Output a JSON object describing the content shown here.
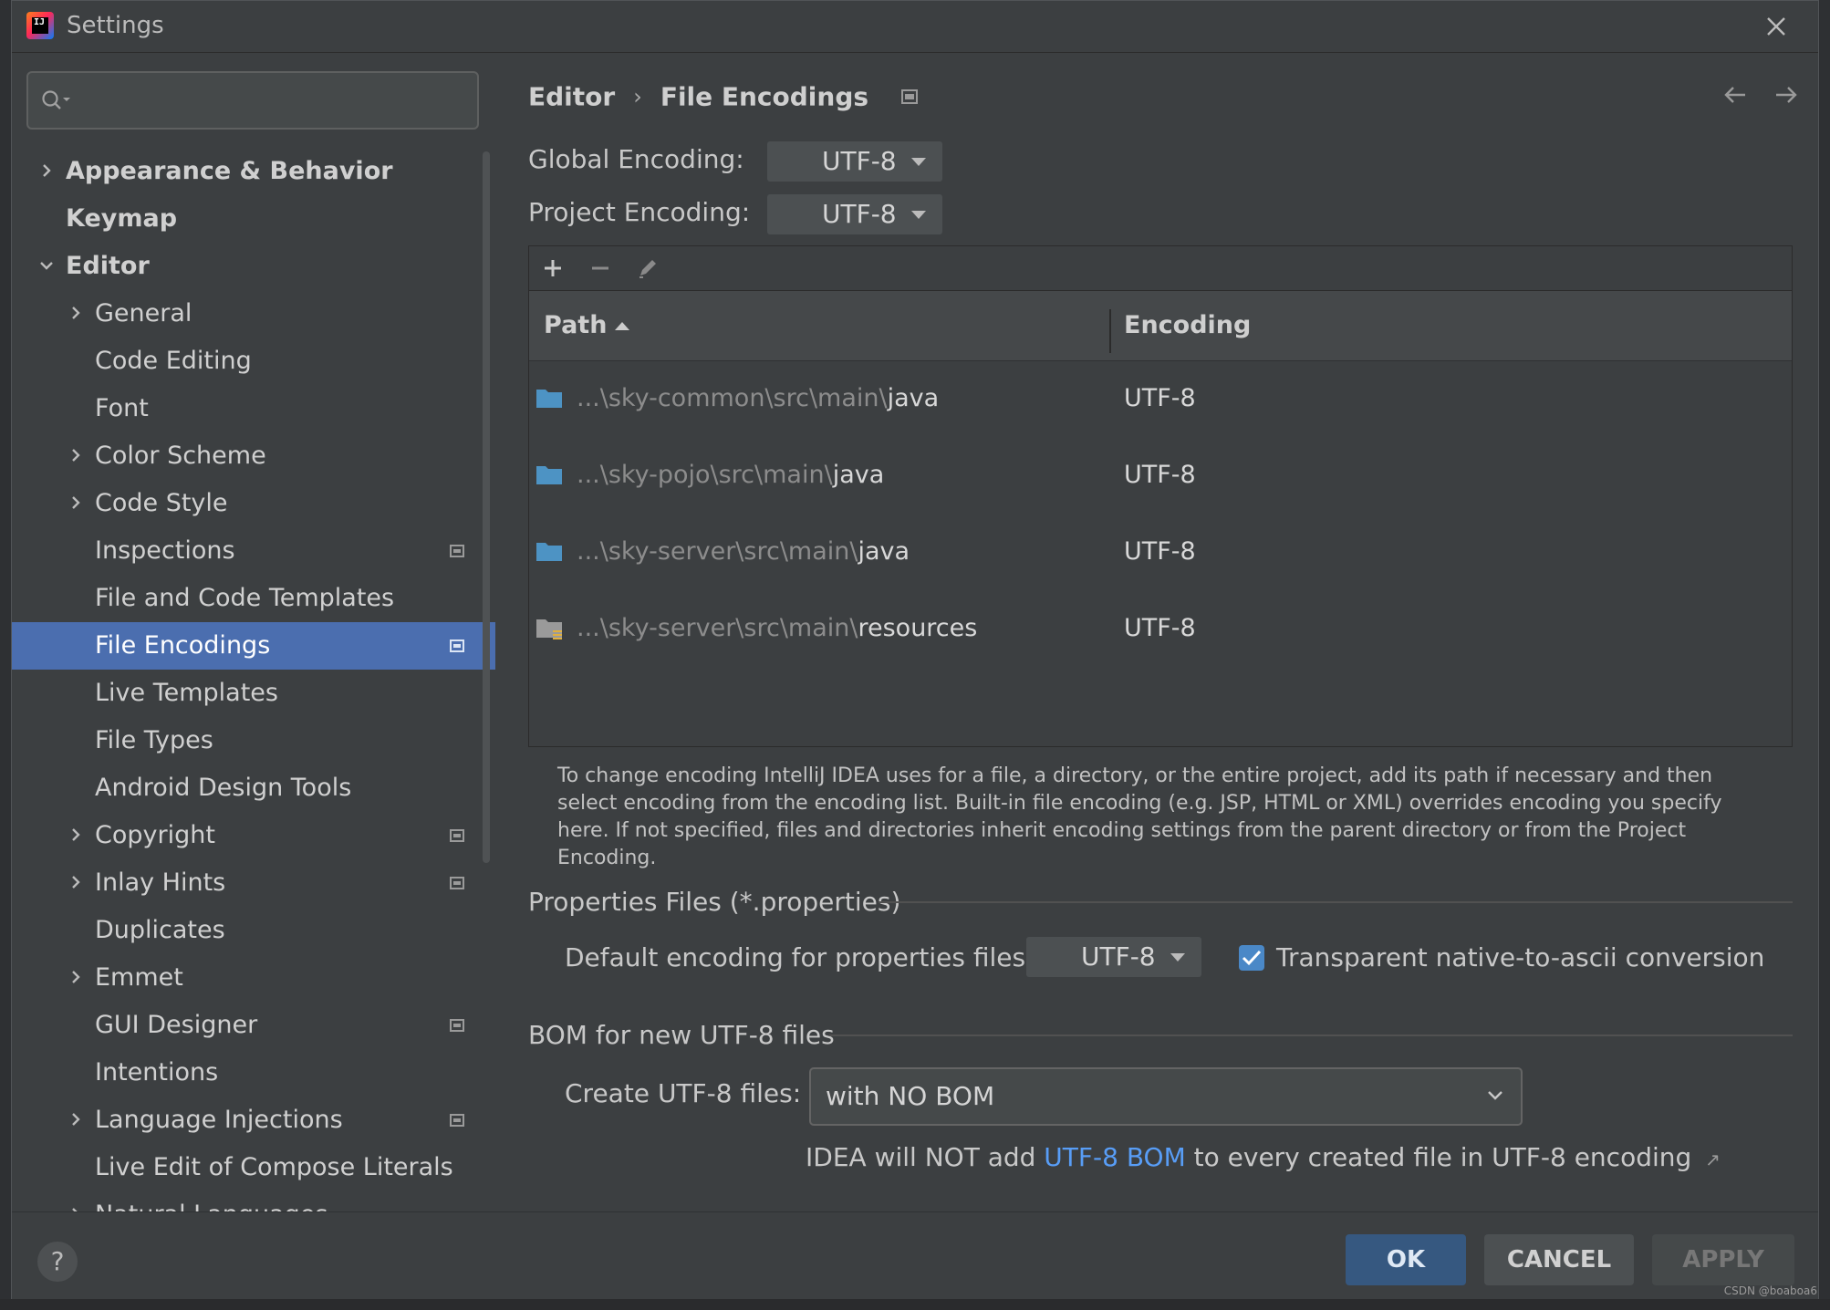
{
  "window": {
    "title": "Settings"
  },
  "search": {
    "placeholder": ""
  },
  "sidebar": {
    "items": [
      {
        "label": "Appearance & Behavior",
        "level": 0,
        "expandable": true,
        "expanded": false,
        "badge": false
      },
      {
        "label": "Keymap",
        "level": 0,
        "expandable": false,
        "expanded": false,
        "badge": false
      },
      {
        "label": "Editor",
        "level": 0,
        "expandable": true,
        "expanded": true,
        "badge": false
      },
      {
        "label": "General",
        "level": 1,
        "expandable": true,
        "expanded": false,
        "badge": false
      },
      {
        "label": "Code Editing",
        "level": 1,
        "expandable": false,
        "expanded": false,
        "badge": false
      },
      {
        "label": "Font",
        "level": 1,
        "expandable": false,
        "expanded": false,
        "badge": false
      },
      {
        "label": "Color Scheme",
        "level": 1,
        "expandable": true,
        "expanded": false,
        "badge": false
      },
      {
        "label": "Code Style",
        "level": 1,
        "expandable": true,
        "expanded": false,
        "badge": false
      },
      {
        "label": "Inspections",
        "level": 1,
        "expandable": false,
        "expanded": false,
        "badge": true
      },
      {
        "label": "File and Code Templates",
        "level": 1,
        "expandable": false,
        "expanded": false,
        "badge": false
      },
      {
        "label": "File Encodings",
        "level": 1,
        "expandable": false,
        "expanded": false,
        "badge": true,
        "selected": true
      },
      {
        "label": "Live Templates",
        "level": 1,
        "expandable": false,
        "expanded": false,
        "badge": false
      },
      {
        "label": "File Types",
        "level": 1,
        "expandable": false,
        "expanded": false,
        "badge": false
      },
      {
        "label": "Android Design Tools",
        "level": 1,
        "expandable": false,
        "expanded": false,
        "badge": false
      },
      {
        "label": "Copyright",
        "level": 1,
        "expandable": true,
        "expanded": false,
        "badge": true
      },
      {
        "label": "Inlay Hints",
        "level": 1,
        "expandable": true,
        "expanded": false,
        "badge": true
      },
      {
        "label": "Duplicates",
        "level": 1,
        "expandable": false,
        "expanded": false,
        "badge": false
      },
      {
        "label": "Emmet",
        "level": 1,
        "expandable": true,
        "expanded": false,
        "badge": false
      },
      {
        "label": "GUI Designer",
        "level": 1,
        "expandable": false,
        "expanded": false,
        "badge": true
      },
      {
        "label": "Intentions",
        "level": 1,
        "expandable": false,
        "expanded": false,
        "badge": false
      },
      {
        "label": "Language Injections",
        "level": 1,
        "expandable": true,
        "expanded": false,
        "badge": true
      },
      {
        "label": "Live Edit of Compose Literals",
        "level": 1,
        "expandable": false,
        "expanded": false,
        "badge": false
      },
      {
        "label": "Natural Languages",
        "level": 1,
        "expandable": true,
        "expanded": false,
        "badge": false
      }
    ]
  },
  "breadcrumb": {
    "parent": "Editor",
    "separator": "›",
    "current": "File Encodings"
  },
  "global_encoding": {
    "label": "Global Encoding:",
    "value": "UTF-8"
  },
  "project_encoding": {
    "label": "Project Encoding:",
    "value": "UTF-8"
  },
  "table": {
    "toolbar": [
      "add-icon",
      "remove-icon",
      "edit-icon"
    ],
    "columns": {
      "path": "Path",
      "encoding": "Encoding"
    },
    "rows": [
      {
        "prefix": "...\\sky-common\\src\\main\\",
        "leaf": "java",
        "encoding": "UTF-8",
        "icon": "folder-icon"
      },
      {
        "prefix": "...\\sky-pojo\\src\\main\\",
        "leaf": "java",
        "encoding": "UTF-8",
        "icon": "folder-icon"
      },
      {
        "prefix": "...\\sky-server\\src\\main\\",
        "leaf": "java",
        "encoding": "UTF-8",
        "icon": "folder-icon"
      },
      {
        "prefix": "...\\sky-server\\src\\main\\",
        "leaf": "resources",
        "encoding": "UTF-8",
        "icon": "resources-folder-icon"
      }
    ]
  },
  "help_text": "To change encoding IntelliJ IDEA uses for a file, a directory, or the entire project, add its path if necessary and then select encoding from the encoding list. Built-in file encoding (e.g. JSP, HTML or XML) overrides encoding you specify here. If not specified, files and directories inherit encoding settings from the parent directory or from the Project Encoding.",
  "properties": {
    "section_title": "Properties Files (*.properties)",
    "default_label": "Default encoding for properties files:",
    "default_value": "UTF-8",
    "native_to_ascii_label": "Transparent native-to-ascii conversion",
    "native_to_ascii_checked": true
  },
  "bom": {
    "section_title": "BOM for new UTF-8 files",
    "create_label": "Create UTF-8 files:",
    "create_value": "with NO BOM",
    "note_before": "IDEA will NOT add ",
    "note_link": "UTF-8 BOM",
    "note_after": " to every created file in UTF-8 encoding",
    "note_arrow": "↗"
  },
  "footer": {
    "help": "?",
    "ok": "OK",
    "cancel": "CANCEL",
    "apply": "APPLY"
  },
  "watermark": "CSDN @boaboa6",
  "colors": {
    "accent": "#4b6eaf",
    "link": "#589df6",
    "ok_button": "#365880",
    "folder": "#4d93c4"
  }
}
